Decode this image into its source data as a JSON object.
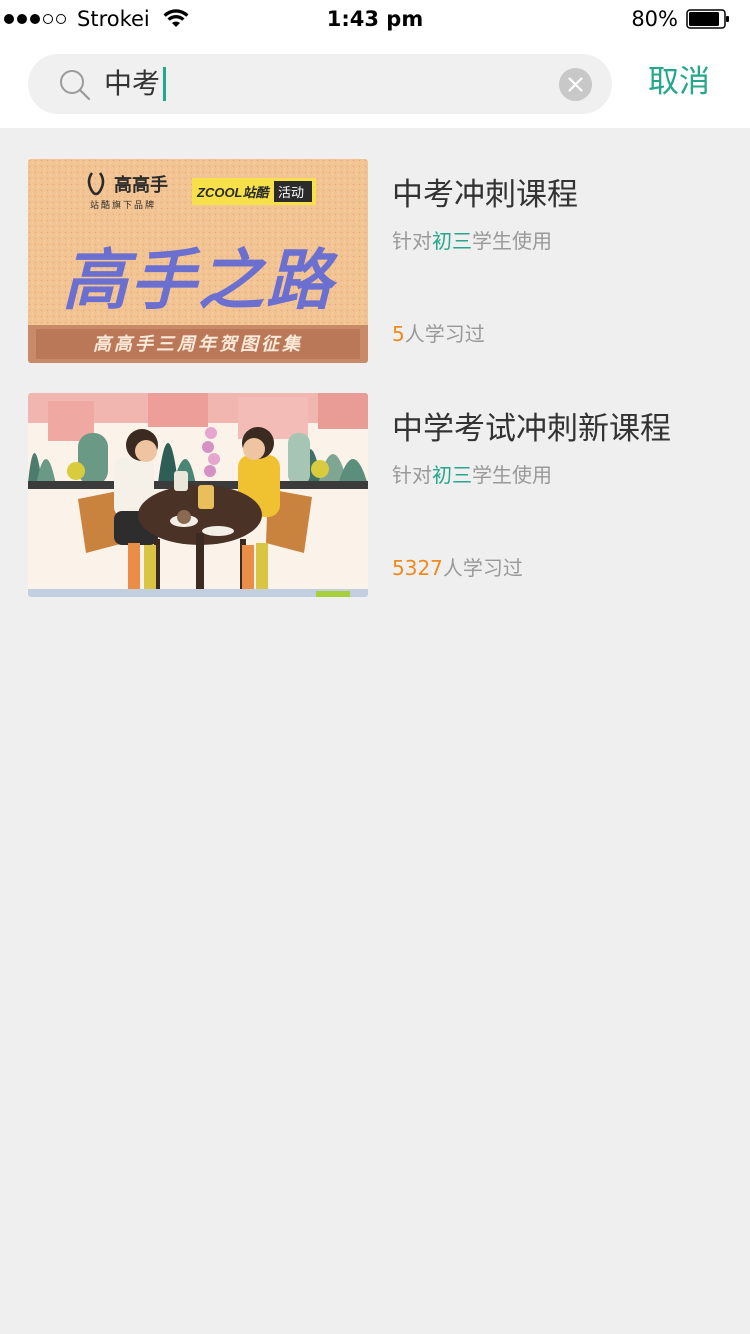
{
  "status_bar": {
    "carrier": "Strokei",
    "time": "1:43 pm",
    "battery": "80%",
    "signal_icon": "signal-dots-icon",
    "wifi_icon": "wifi-icon",
    "battery_icon": "battery-icon"
  },
  "search": {
    "query": "中考",
    "cancel_label": "取消",
    "search_icon": "search-icon",
    "clear_icon": "clear-icon"
  },
  "courses": [
    {
      "title": "中考冲刺课程",
      "meta_prefix": "针对",
      "meta_grade": "初三",
      "meta_suffix": "学生使用",
      "learned_count": "5",
      "learned_suffix": "人学习过",
      "thumb": {
        "brand": "高高手",
        "brand_sub": "站酷旗下品牌",
        "zcool": "ZCOOL站酷",
        "badge": "活动",
        "headline": "高手之路",
        "banner": "高高手三周年贺图征集"
      }
    },
    {
      "title": "中学考试冲刺新课程",
      "meta_prefix": "针对",
      "meta_grade": "初三",
      "meta_suffix": "学生使用",
      "learned_count": "5327",
      "learned_suffix": "人学习过",
      "thumb": {
        "description": "illustration-couple-cafe"
      }
    }
  ],
  "colors": {
    "accent": "#24a78a",
    "orange": "#f08a1c",
    "background": "#efefef"
  }
}
